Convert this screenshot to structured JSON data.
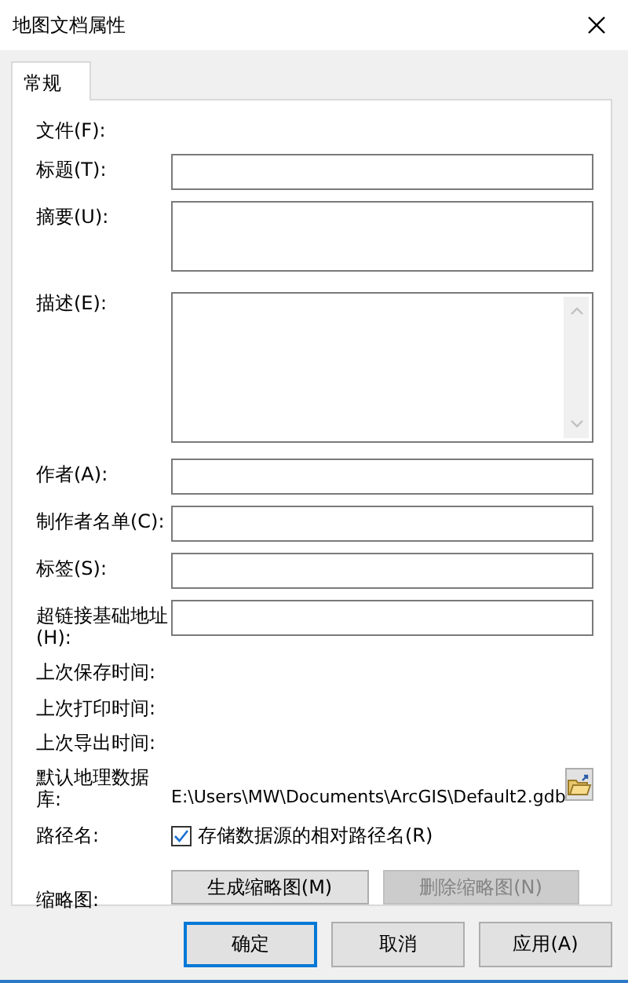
{
  "window": {
    "title": "地图文档属性"
  },
  "tabs": [
    {
      "label": "常规",
      "selected": true
    }
  ],
  "rows": [
    {
      "kind": "text",
      "label": "文件(F):"
    },
    {
      "kind": "input",
      "label": "标题(T):"
    },
    {
      "kind": "memo",
      "label": "摘要(U):"
    },
    {
      "kind": "scroll_memo",
      "label": "描述(E):"
    },
    {
      "kind": "input",
      "label": "作者(A):"
    },
    {
      "kind": "input",
      "label": "制作者名单(C):"
    },
    {
      "kind": "input",
      "label": "标签(S):"
    },
    {
      "kind": "input",
      "label": "超链接基础地址(H):"
    },
    {
      "kind": "text",
      "label": "上次保存时间:"
    },
    {
      "kind": "text",
      "label": "上次打印时间:"
    },
    {
      "kind": "text",
      "label": "上次导出时间:"
    },
    {
      "kind": "path",
      "label": "默认地理数据库:",
      "value": "E:\\Users\\MW\\Documents\\ArcGIS\\Default2.gdb"
    },
    {
      "kind": "checkbox",
      "label": "路径名:",
      "option": "存储数据源的相对路径名(R)",
      "checked": true
    },
    {
      "kind": "buttons",
      "label": "缩略图:",
      "buttons": [
        {
          "label": "生成缩略图(M)",
          "disabled": false
        },
        {
          "label": "删除缩略图(N)",
          "disabled": true
        }
      ]
    }
  ],
  "buttons": [
    {
      "label": "确定",
      "default": true
    },
    {
      "label": "取消",
      "default": false
    },
    {
      "label": "应用(A)",
      "default": false
    }
  ]
}
